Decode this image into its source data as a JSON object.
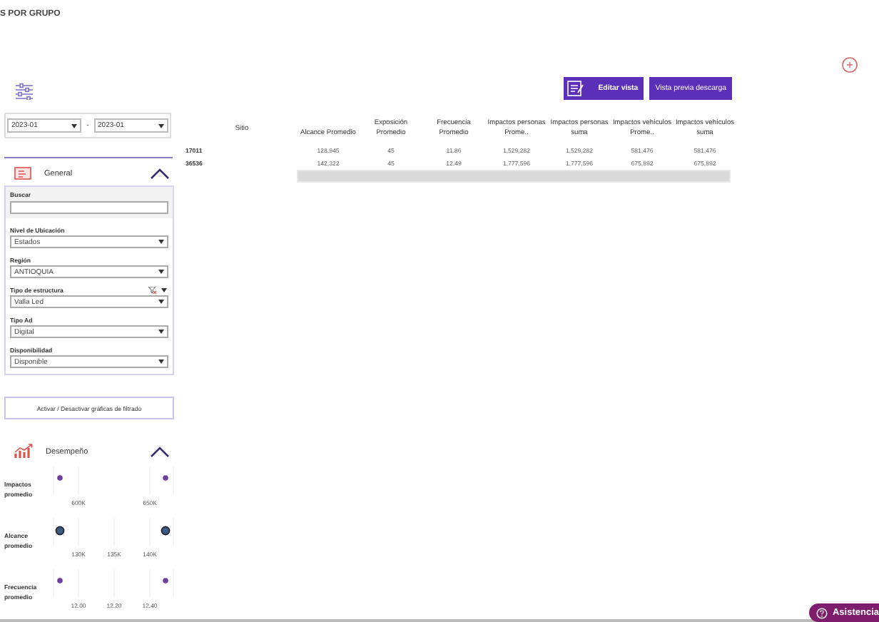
{
  "page_title": "S POR GRUPO",
  "toolbar": {
    "buttons": [
      {
        "label": "Editar vista",
        "kind": "icon"
      },
      {
        "label": "Vista previa descarga",
        "kind": "plain"
      }
    ]
  },
  "date_range": {
    "from": "2023-01",
    "separator": "-",
    "to": "2023-01"
  },
  "general": {
    "title": "General",
    "expanded": true,
    "search": {
      "label": "Buscar"
    },
    "filters": [
      {
        "label": "Nivel de Ubicación",
        "value": "Estados",
        "clear_filter": false
      },
      {
        "label": "Región",
        "value": "ANTIOQUIA",
        "clear_filter": false
      },
      {
        "label": "Tipo de estructura",
        "value": "Valla Led",
        "clear_filter": true
      },
      {
        "label": "Tipo Ad",
        "value": "Digital",
        "clear_filter": false
      },
      {
        "label": "Disponibilidad",
        "value": "Disponible",
        "clear_filter": false
      }
    ]
  },
  "toggle_button": "Activar / Desactivar gráficas de filtrado",
  "performance": {
    "title": "Desempeño",
    "expanded": true,
    "charts": [
      {
        "label": "Impactos promedio",
        "kind": "plain",
        "ticks": [
          "600K",
          "650K"
        ]
      },
      {
        "label": "Alcance promedio",
        "kind": "highlighted",
        "ticks": [
          "130K",
          "135K",
          "140K"
        ]
      },
      {
        "label": "Frecuencia promedio",
        "kind": "plain",
        "ticks": [
          "12.00",
          "12.20",
          "12.40"
        ]
      }
    ]
  },
  "table": {
    "columns": [
      "Sitio",
      "Alcance Promedio",
      "Exposición Promedio",
      "Frecuencia Promedio",
      "Impactos personas Prome..",
      "Impactos personas suma",
      "Impactos vehículos Prome..",
      "Impactos vehículos suma"
    ],
    "rows": [
      {
        "cells": [
          "17011",
          "128,945",
          "45",
          "11.86",
          "1,529,282",
          "1,529,282",
          "581,476",
          "581,476"
        ]
      },
      {
        "cells": [
          "36536",
          "142,322",
          "45",
          "12.49",
          "1,777,596",
          "1,777,596",
          "675,892",
          "675,892"
        ]
      }
    ]
  },
  "help_button": {
    "label": "Asistencia"
  }
}
